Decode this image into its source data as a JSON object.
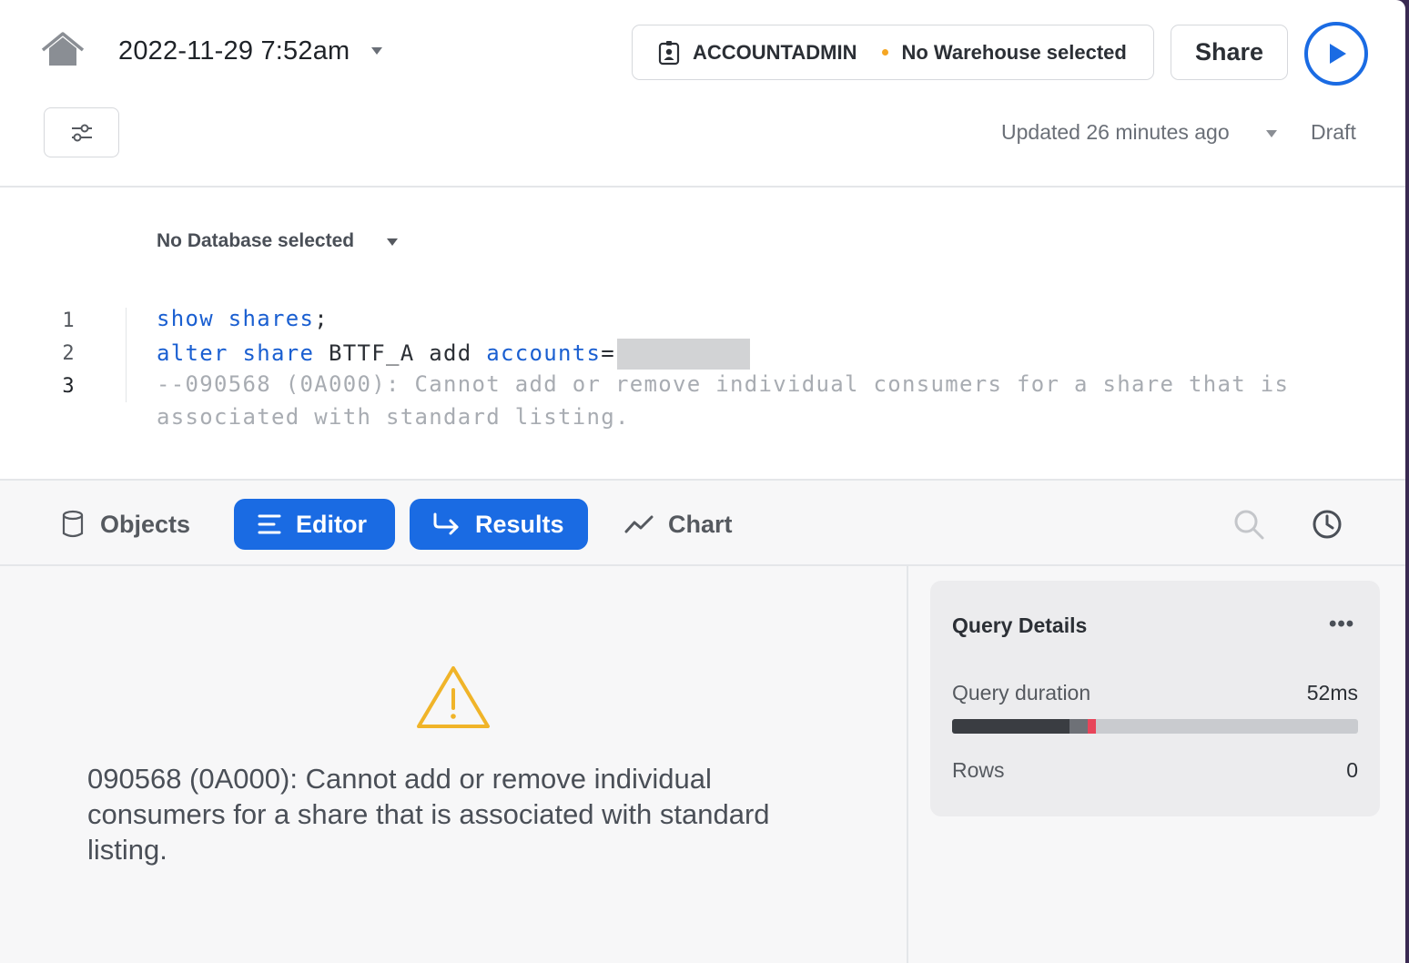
{
  "header": {
    "title": "2022-11-29 7:52am",
    "role": "ACCOUNTADMIN",
    "warehouse": "No Warehouse selected",
    "share_label": "Share",
    "updated": "Updated 26 minutes ago",
    "status": "Draft"
  },
  "editor": {
    "database": "No Database selected",
    "line_numbers": [
      "1",
      "2",
      "3"
    ],
    "line1": {
      "kw1": "show",
      "kw2": "shares",
      "rest": ";"
    },
    "line2": {
      "kw1": "alter",
      "kw2": "share",
      "mid": "BTTF_A add",
      "kw3": "accounts",
      "rest": "="
    },
    "line3a": "--090568 (0A000): Cannot add or remove individual consumers for a share that is",
    "line3b": "associated with standard listing."
  },
  "tabs": {
    "objects": "Objects",
    "editor": "Editor",
    "results": "Results",
    "chart": "Chart"
  },
  "results": {
    "error_message": "090568 (0A000): Cannot add or remove individual consumers for a share that is associated with standard listing."
  },
  "query_details": {
    "title": "Query Details",
    "menu": "•••",
    "duration_label": "Query duration",
    "duration_value": "52ms",
    "rows_label": "Rows",
    "rows_value": "0"
  },
  "colors": {
    "accent": "#1a6be3",
    "keyword": "#1a5fd1",
    "warning": "#f0b429",
    "warehouse_dot": "#f5a623"
  },
  "icons": [
    "home-icon",
    "caret-down-icon",
    "role-icon",
    "run-icon",
    "filter-icon",
    "database-icon",
    "editor-lines-icon",
    "results-arrow-icon",
    "chart-line-icon",
    "search-icon",
    "history-clock-icon",
    "warning-icon"
  ]
}
